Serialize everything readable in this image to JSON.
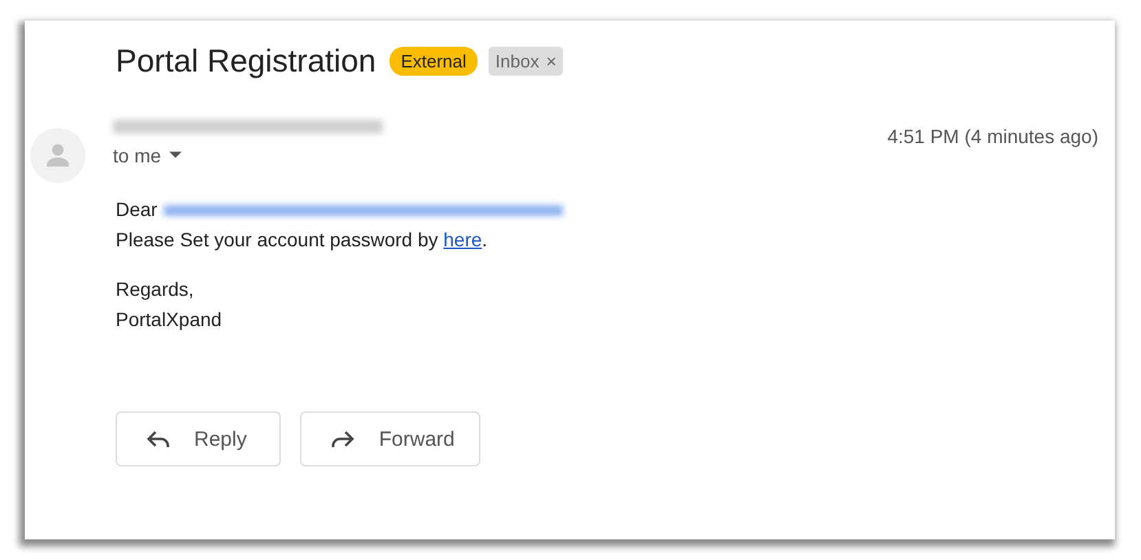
{
  "subject": "Portal Registration",
  "labels": [
    {
      "text": "External",
      "color": "#fbbc04",
      "removable": false
    },
    {
      "text": "Inbox",
      "color": "#dddddd",
      "removable": true,
      "remove_icon": "×"
    }
  ],
  "sender": {
    "redacted": true
  },
  "recipient_line": "to me",
  "time": "4:51 PM (4 minutes ago)",
  "body": {
    "greeting": "Dear",
    "recipient_redacted": true,
    "line_before_link": "Please Set your account password by ",
    "link": "here",
    "line_after_link": ".",
    "closing": "Regards,",
    "signature": "PortalXpand"
  },
  "actions": [
    {
      "kind": "reply",
      "label": "Reply"
    },
    {
      "kind": "forward",
      "label": "Forward"
    }
  ]
}
